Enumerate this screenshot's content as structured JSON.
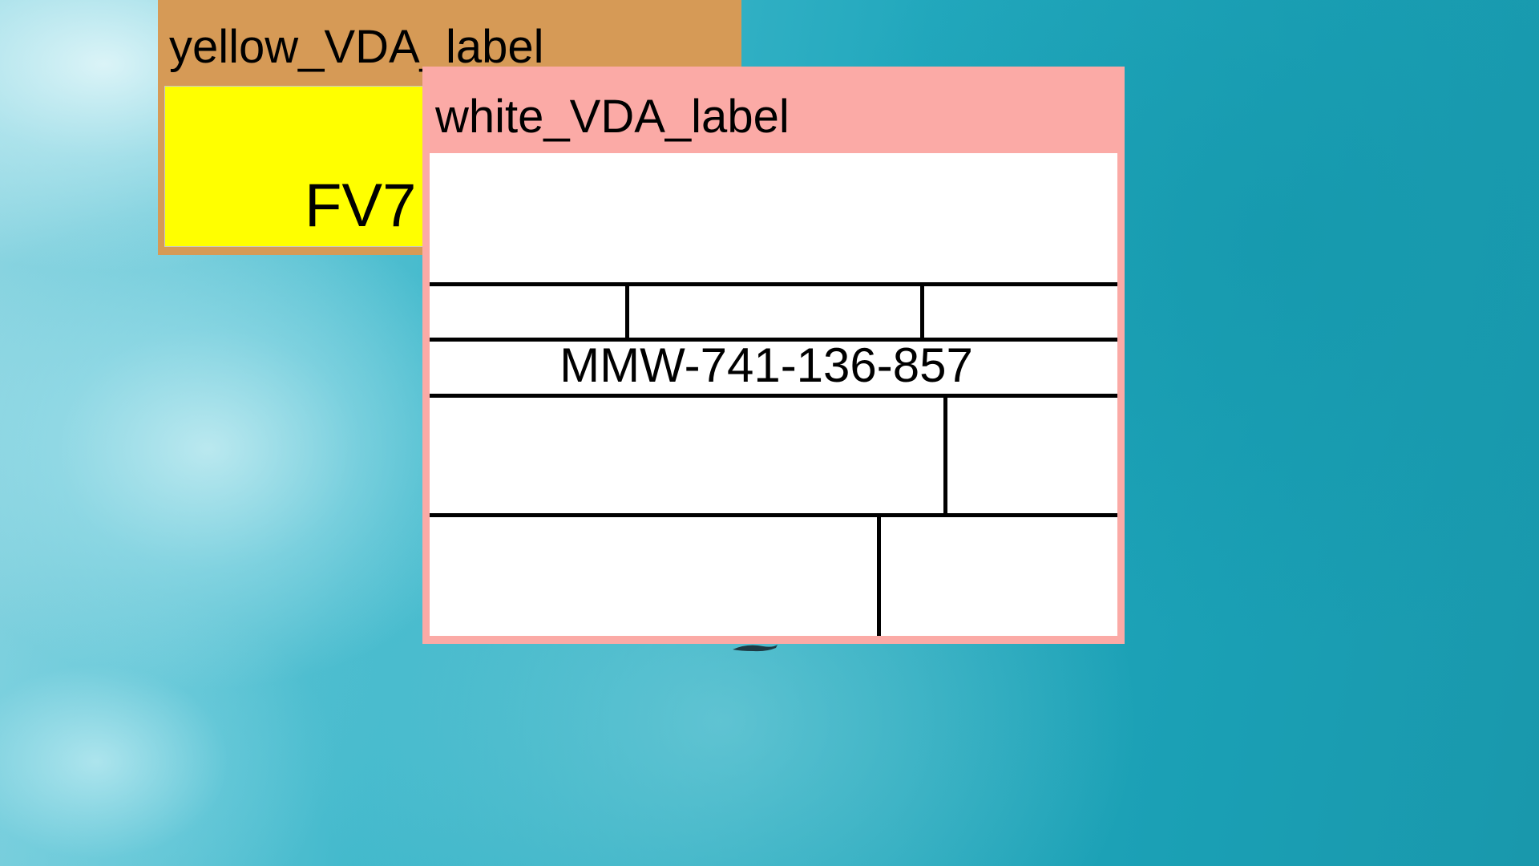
{
  "windows": {
    "yellow": {
      "title": "yellow_VDA_label",
      "code": "FV7",
      "frame_color": "#d69a56",
      "body_color": "#ffff00"
    },
    "white": {
      "title": "white_VDA_label",
      "serial": "MMW-741-136-857",
      "frame_color": "#fbaaa6",
      "body_color": "#ffffff"
    }
  },
  "desktop": {
    "background": "ocean-aerial-wallpaper"
  }
}
